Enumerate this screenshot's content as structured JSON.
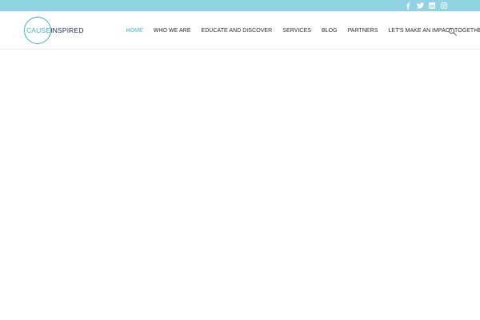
{
  "topbar": {
    "social": [
      {
        "icon": "facebook-icon",
        "glyph": "f"
      },
      {
        "icon": "twitter-icon",
        "glyph": "t"
      },
      {
        "icon": "linkedin-icon",
        "glyph": "in"
      },
      {
        "icon": "instagram-icon",
        "glyph": "ig"
      }
    ],
    "color": "#91d3e2"
  },
  "header": {
    "logo": {
      "cause": "CAUSE",
      "inspired": "INSPIRED"
    },
    "nav": [
      {
        "label": "HOME",
        "active": true
      },
      {
        "label": "WHO WE ARE",
        "active": false
      },
      {
        "label": "EDUCATE AND DISCOVER",
        "active": false
      },
      {
        "label": "SERVICES",
        "active": false
      },
      {
        "label": "BLOG",
        "active": false
      },
      {
        "label": "PARTNERS",
        "active": false
      },
      {
        "label": "LET'S MAKE AN IMPACT TOGETHER",
        "active": false
      }
    ],
    "search_icon": "search-icon",
    "accent": "#3fb6cf",
    "brand_dark": "#22335a"
  }
}
